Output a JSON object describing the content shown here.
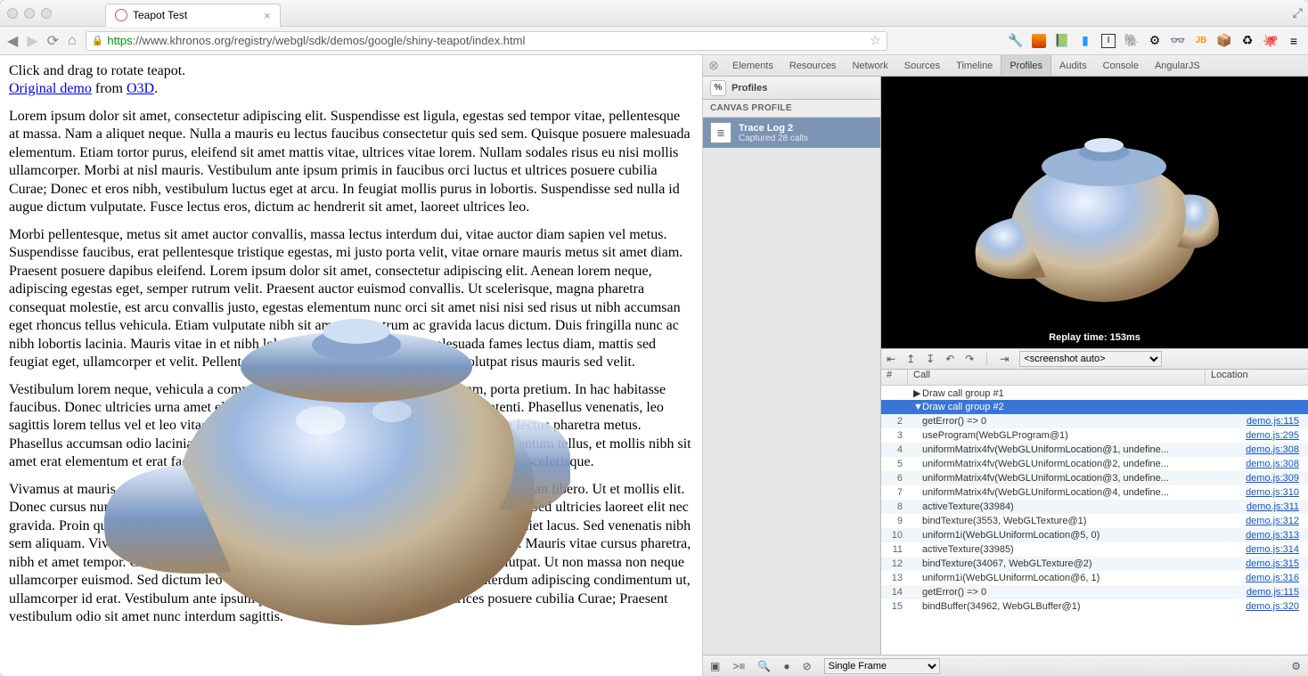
{
  "window": {
    "tab_title": "Teapot Test"
  },
  "omnibar": {
    "scheme": "https",
    "host_path": "://www.khronos.org/registry/webgl/sdk/demos/google/shiny-teapot/index.html"
  },
  "page": {
    "intro": "Click and drag to rotate teapot.",
    "link1": "Original demo",
    "from": " from ",
    "link2": "O3D",
    "period": ".",
    "p1": "Lorem ipsum dolor sit amet, consectetur adipiscing elit. Suspendisse est ligula, egestas sed tempor vitae, pellentesque at massa. Nam a aliquet neque. Nulla a mauris eu lectus faucibus consectetur quis sed sem. Quisque posuere malesuada elementum. Etiam tortor purus, eleifend sit amet mattis vitae, ultrices vitae lorem. Nullam sodales risus eu nisi mollis ullamcorper. Morbi at nisl mauris. Vestibulum ante ipsum primis in faucibus orci luctus et ultrices posuere cubilia Curae; Donec et eros nibh, vestibulum luctus eget at arcu. In feugiat mollis purus in lobortis. Suspendisse sed nulla id augue dictum vulputate. Fusce lectus eros, dictum ac hendrerit sit amet, laoreet ultrices leo.",
    "p2": "Morbi pellentesque, metus sit amet auctor convallis, massa lectus interdum dui, vitae auctor diam sapien vel metus. Suspendisse faucibus, erat pellentesque tristique egestas, mi justo porta velit, vitae ornare mauris metus sit amet diam. Praesent posuere dapibus eleifend. Lorem ipsum dolor sit amet, consectetur adipiscing elit. Aenean lorem neque, adipiscing egestas eget, semper rutrum velit. Praesent auctor euismod convallis. Ut scelerisque, magna pharetra consequat molestie, est arcu convallis justo, egestas elementum nunc orci sit amet nisi nisi sed risus ut nibh accumsan eget rhoncus tellus vehicula. Etiam vulputate nibh sit amet nisi rutrum ac gravida lacus dictum. Duis fringilla nunc ac nibh lobortis lacinia. Mauris vitae in et nibh lobortis lacinia. Interdum et malesuada fames lectus diam, mattis sed feugiat eget, ullamcorper et velit. Pellentesque libero odio lacinia ac velit, eget volutpat risus mauris sed velit.",
    "p3": "Vestibulum lorem neque, vehicula a commodo facilisis quis libero. Integer aliquam, porta pretium. In hac habitasse faucibus. Donec ultricies urna amet elit. Praesent eget pellentesque quam molestie potenti. Phasellus venenatis, leo sagittis lorem tellus vel et leo vitae neque nec. Duis eu dignissim nisi. Nulla facilisi urna lectus pharetra metus. Phasellus accumsan odio lacinia nibh auctor tempor laoreet odio facilisi, nulla lacus elementum tellus, et mollis nibh sit amet erat elementum et erat facilisi quisi ac fermentum quam consequat. Proin augue nibh scelerisque.",
    "p4": "Vivamus at mauris velit. Pellentesque libero. Ut sit amet quam interdum lectus, quis accumsan libero. Ut et mollis elit. Donec cursus nunc ut tristique aliquet. Proin ac ante id. Proin ac ante sem, quis egestas mi. Sed ultricies laoreet elit nec gravida. Proin quis elit id tempor congue, praesent et nibh. Nulla eget enim odio, ut imperdiet lacus. Sed venenatis nibh sem aliquam. Vivamus mattis diam in sagittis risus volutpat vitae. Aenean aliquet odio sit. Mauris vitae cursus pharetra, nibh et amet tempor. Curabitur faucibus gravida turpis, vel eleifend risus malesuada volutpat. Ut non massa non neque ullamcorper euismod. Sed dictum leo eu mi egestas tincidunt. Nullam leo magna, interdum adipiscing condimentum ut, ullamcorper id erat. Vestibulum ante ipsum primis in faucibus orci luctus et ultrices posuere cubilia Curae; Praesent vestibulum odio sit amet nunc interdum sagittis."
  },
  "devtools": {
    "tabs": [
      "Elements",
      "Resources",
      "Network",
      "Sources",
      "Timeline",
      "Profiles",
      "Audits",
      "Console",
      "AngularJS"
    ],
    "active_tab": "Profiles",
    "sidebar": {
      "head": "Profiles",
      "section": "CANVAS PROFILE",
      "item_title": "Trace Log 2",
      "item_sub": "Captured 28 calls"
    },
    "replay_label": "Replay time: 153ms",
    "screenshot_select": "<screenshot auto>",
    "trace_head": {
      "num": "#",
      "call": "Call",
      "loc": "Location"
    },
    "groups": [
      {
        "label": "Draw call group #1",
        "expanded": false,
        "selected": false
      },
      {
        "label": "Draw call group #2",
        "expanded": true,
        "selected": true
      }
    ],
    "calls": [
      {
        "n": 2,
        "c": "getError() => 0",
        "l": "demo.js:115"
      },
      {
        "n": 3,
        "c": "useProgram(WebGLProgram@1)",
        "l": "demo.js:295"
      },
      {
        "n": 4,
        "c": "uniformMatrix4fv(WebGLUniformLocation@1, undefine...",
        "l": "demo.js:308"
      },
      {
        "n": 5,
        "c": "uniformMatrix4fv(WebGLUniformLocation@2, undefine...",
        "l": "demo.js:308"
      },
      {
        "n": 6,
        "c": "uniformMatrix4fv(WebGLUniformLocation@3, undefine...",
        "l": "demo.js:309"
      },
      {
        "n": 7,
        "c": "uniformMatrix4fv(WebGLUniformLocation@4, undefine...",
        "l": "demo.js:310"
      },
      {
        "n": 8,
        "c": "activeTexture(33984)",
        "l": "demo.js:311"
      },
      {
        "n": 9,
        "c": "bindTexture(3553, WebGLTexture@1)",
        "l": "demo.js:312"
      },
      {
        "n": 10,
        "c": "uniform1i(WebGLUniformLocation@5, 0)",
        "l": "demo.js:313"
      },
      {
        "n": 11,
        "c": "activeTexture(33985)",
        "l": "demo.js:314"
      },
      {
        "n": 12,
        "c": "bindTexture(34067, WebGLTexture@2)",
        "l": "demo.js:315"
      },
      {
        "n": 13,
        "c": "uniform1i(WebGLUniformLocation@6, 1)",
        "l": "demo.js:316"
      },
      {
        "n": 14,
        "c": "getError() => 0",
        "l": "demo.js:115"
      },
      {
        "n": 15,
        "c": "bindBuffer(34962, WebGLBuffer@1)",
        "l": "demo.js:320"
      }
    ],
    "footer_select": "Single Frame"
  }
}
